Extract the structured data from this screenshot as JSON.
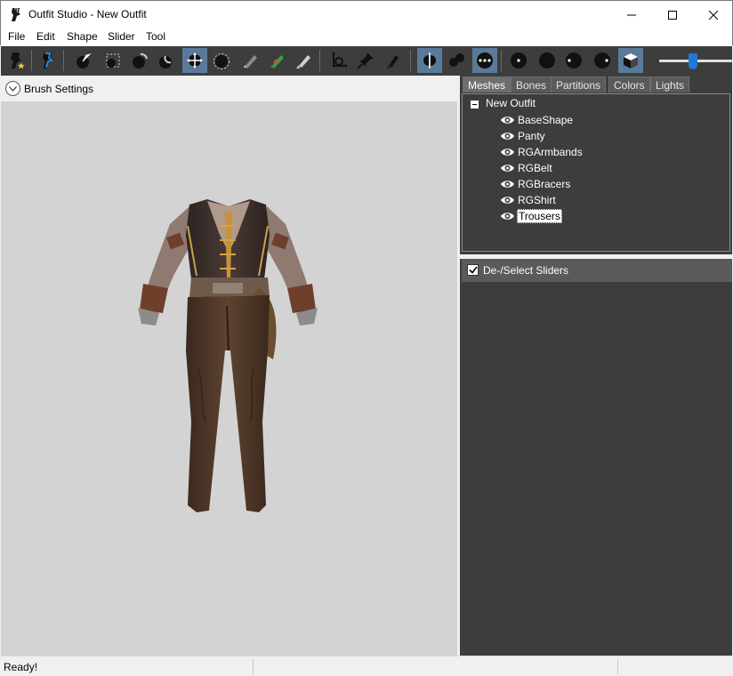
{
  "window": {
    "title": "Outfit Studio - New Outfit"
  },
  "menu": [
    "File",
    "Edit",
    "Shape",
    "Slider",
    "Tool"
  ],
  "toolbar": {
    "icons": [
      "load-reference-icon",
      "load-outfit-icon",
      "select-brush-icon",
      "mask-brush-icon",
      "inflate-brush-icon",
      "deflate-brush-icon",
      "move-brush-icon",
      "smooth-brush-icon",
      "undiff-brush-icon",
      "weight-brush-icon",
      "color-brush-icon",
      "alpha-brush-icon",
      "transform-icon",
      "pivot-icon",
      "vertex-edit-icon",
      "mirror-x-icon",
      "symmetry-icon",
      "connected-only-icon",
      "view-front-icon",
      "view-back-icon",
      "view-left-icon",
      "view-right-icon",
      "lighting-icon",
      "zoom-slider"
    ],
    "zoom_value": 0.5
  },
  "left": {
    "brush_settings_label": "Brush Settings"
  },
  "tabs": [
    "Meshes",
    "Bones",
    "Partitions",
    "Colors",
    "Lights"
  ],
  "active_tab": "Meshes",
  "meshes": {
    "root": "New Outfit",
    "items": [
      "BaseShape",
      "Panty",
      "RGArmbands",
      "RGBelt",
      "RGBracers",
      "RGShirt",
      "Trousers"
    ],
    "selected": "Trousers"
  },
  "sliders": {
    "header_label": "De-/Select Sliders",
    "checked": true
  },
  "status": {
    "text": "Ready!"
  },
  "colors": {
    "dark_panel": "#3d3d3d",
    "viewport_bg": "#d3d3d3",
    "active_tool": "#5a7a9a",
    "slider_accent": "#1f7ad6"
  }
}
